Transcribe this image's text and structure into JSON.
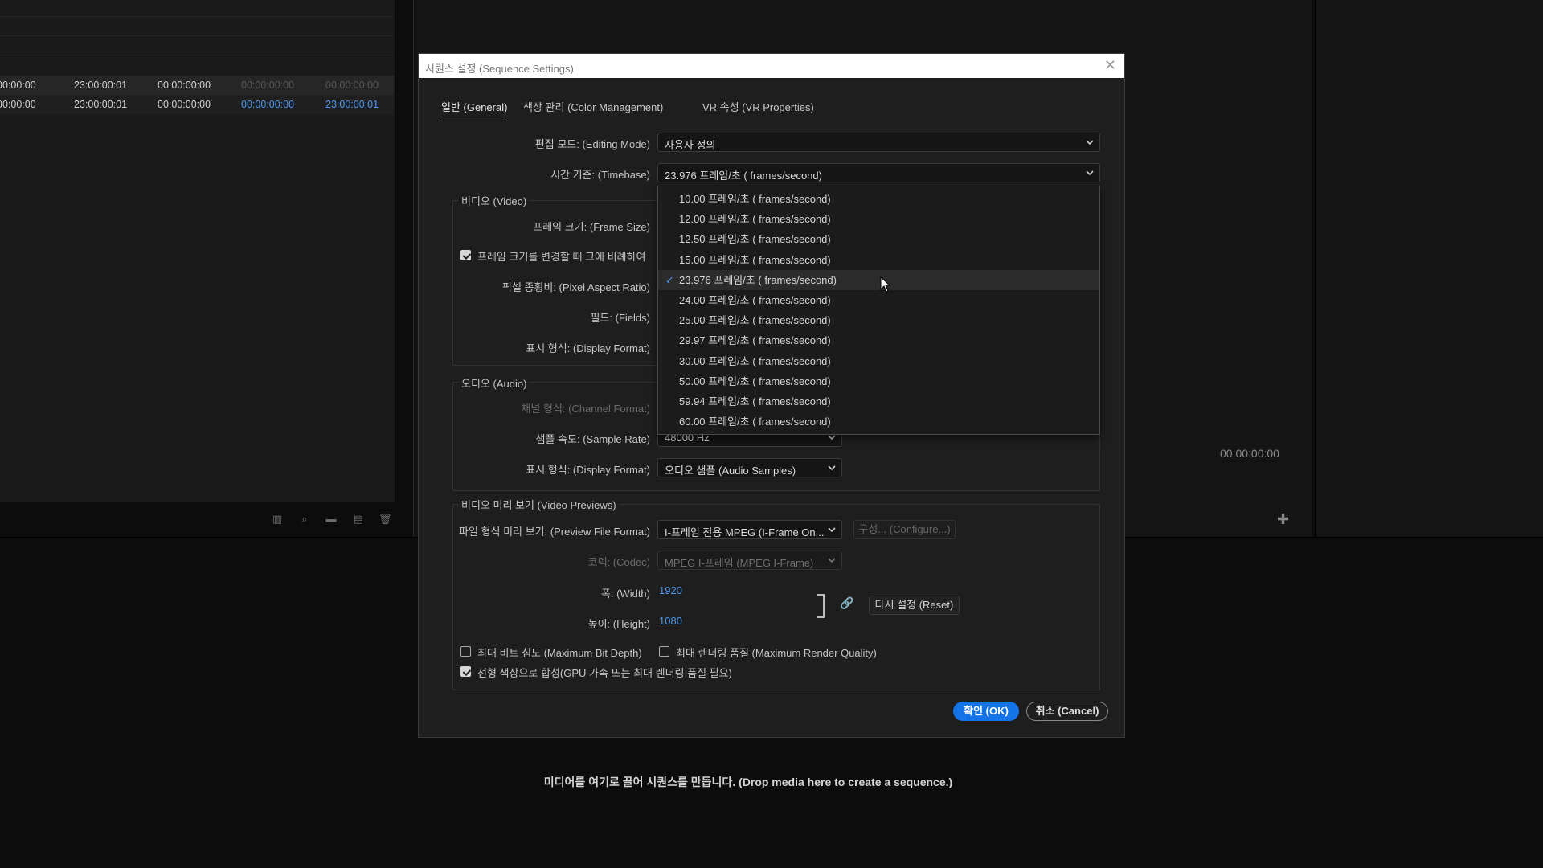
{
  "background": {
    "timecode_rows": [
      [
        "00:00:00",
        "23:00:00:01",
        "00:00:00:00",
        "00:00:00:00",
        "00:00:00:00"
      ],
      [
        "00:00:00",
        "23:00:00:01",
        "00:00:00:00",
        "00:00:00:00",
        "23:00:00:01"
      ]
    ],
    "program_timecode": "00:00:00:00",
    "drop_hint": "미디어를 여기로 끌어 시퀀스를 만듭니다. (Drop media here to create a sequence.)",
    "toolbar_icons": [
      "list-view-icon",
      "search-icon",
      "new-bin-icon",
      "new-item-icon",
      "trash-icon"
    ]
  },
  "dialog": {
    "title": "시퀀스 설정 (Sequence Settings)",
    "tabs": [
      {
        "label": "일반 (General)",
        "active": true
      },
      {
        "label": "색상 관리 (Color Management)",
        "active": false
      },
      {
        "label": "VR 속성 (VR Properties)",
        "active": false
      }
    ],
    "editing_mode": {
      "label": "편집 모드: (Editing Mode)",
      "value": "사용자 정의"
    },
    "timebase": {
      "label": "시간 기준: (Timebase)",
      "value": "23.976  프레임/초 ( frames/second)"
    },
    "video": {
      "group_title": "비디오 (Video)",
      "frame_size_label": "프레임 크기: (Frame Size)",
      "scale_checkbox_label": "프레임 크기를 변경할 때 그에 비례하여",
      "scale_checked": true,
      "pixel_aspect_label": "픽셀 종횡비: (Pixel Aspect Ratio)",
      "fields_label": "필드: (Fields)",
      "display_format_label": "표시 형식: (Display Format)"
    },
    "audio": {
      "group_title": "오디오 (Audio)",
      "channel_format_label": "채널 형식: (Channel Format)",
      "sample_rate_label": "샘플 속도: (Sample Rate)",
      "sample_rate_value": "48000 Hz",
      "display_format_label": "표시 형식: (Display Format)",
      "display_format_value": "오디오 샘플 (Audio Samples)"
    },
    "previews": {
      "group_title": "비디오 미리 보기 (Video Previews)",
      "file_format_label": "파일 형식 미리 보기: (Preview File Format)",
      "file_format_value": "I-프레임 전용 MPEG (I-Frame On...",
      "configure_label": "구성... (Configure...)",
      "codec_label": "코덱: (Codec)",
      "codec_value": "MPEG I-프레임 (MPEG I-Frame)",
      "width_label": "폭: (Width)",
      "width_value": "1920",
      "height_label": "높이: (Height)",
      "height_value": "1080",
      "reset_label": "다시 설정 (Reset)"
    },
    "options": {
      "max_bit_depth": {
        "label": "최대 비트 심도 (Maximum Bit Depth)",
        "checked": false
      },
      "max_render_quality": {
        "label": "최대 렌더링 품질 (Maximum Render Quality)",
        "checked": false
      },
      "linear_color": {
        "label": "선형 색상으로 합성(GPU 가속 또는 최대 렌더링 품질 필요)",
        "checked": true
      }
    },
    "ok_label": "확인 (OK)",
    "cancel_label": "취소 (Cancel)"
  },
  "timebase_dropdown": {
    "selected": "23.976",
    "options": [
      "10.00  프레임/초 ( frames/second)",
      "12.00  프레임/초 ( frames/second)",
      "12.50  프레임/초 ( frames/second)",
      "15.00  프레임/초 ( frames/second)",
      "23.976  프레임/초 ( frames/second)",
      "24.00  프레임/초 ( frames/second)",
      "25.00  프레임/초 ( frames/second)",
      "29.97  프레임/초 ( frames/second)",
      "30.00  프레임/초 ( frames/second)",
      "50.00  프레임/초 ( frames/second)",
      "59.94  프레임/초 ( frames/second)",
      "60.00  프레임/초 ( frames/second)"
    ]
  },
  "colors": {
    "accent": "#1473e6",
    "link_blue": "#4b97ef",
    "dialog_bg": "#1e1e1e"
  }
}
